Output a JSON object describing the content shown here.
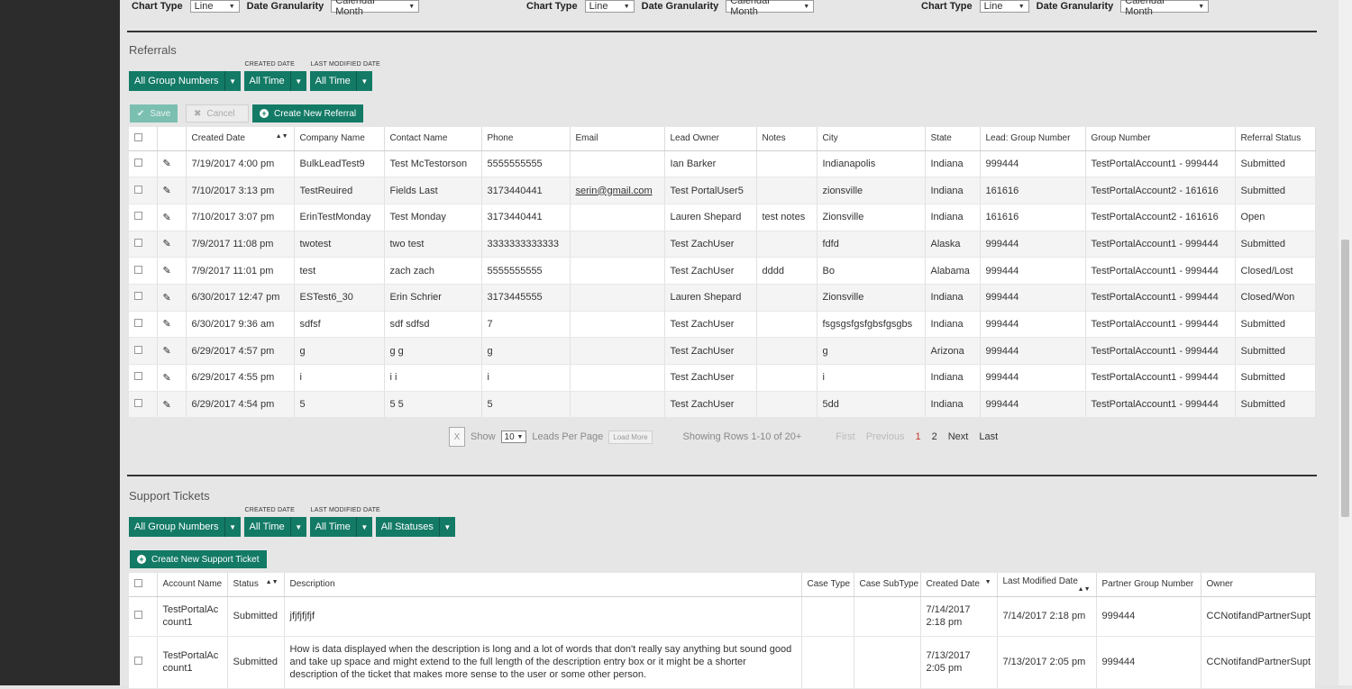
{
  "chart_controls": [
    {
      "chart_type_label": "Chart Type",
      "chart_type_value": "Line",
      "granularity_label": "Date Granularity",
      "granularity_value": "Calendar Month"
    },
    {
      "chart_type_label": "Chart Type",
      "chart_type_value": "Line",
      "granularity_label": "Date Granularity",
      "granularity_value": "Calendar Month"
    },
    {
      "chart_type_label": "Chart Type",
      "chart_type_value": "Line",
      "granularity_label": "Date Granularity",
      "granularity_value": "Calendar Month"
    }
  ],
  "referrals": {
    "title": "Referrals",
    "filters": {
      "group": "All Group Numbers",
      "created_caption": "CREATED DATE",
      "created": "All Time",
      "modified_caption": "LAST MODIFIED DATE",
      "modified": "All Time"
    },
    "save_label": "Save",
    "cancel_label": "Cancel",
    "create_label": "Create New Referral",
    "columns": [
      "Created Date",
      "Company Name",
      "Contact Name",
      "Phone",
      "Email",
      "Lead Owner",
      "Notes",
      "City",
      "State",
      "Lead: Group Number",
      "Group Number",
      "Referral Status"
    ],
    "rows": [
      [
        "7/19/2017 4:00 pm",
        "BulkLeadTest9",
        "Test McTestorson",
        "5555555555",
        "",
        "Ian Barker",
        "",
        "Indianapolis",
        "Indiana",
        "999444",
        "TestPortalAccount1 - 999444",
        "Submitted"
      ],
      [
        "7/10/2017 3:13 pm",
        "TestReuired",
        "Fields Last",
        "3173440441",
        "serin@gmail.com",
        "Test PortalUser5",
        "",
        "zionsville",
        "Indiana",
        "161616",
        "TestPortalAccount2 - 161616",
        "Submitted"
      ],
      [
        "7/10/2017 3:07 pm",
        "ErinTestMonday",
        "Test Monday",
        "3173440441",
        "",
        "Lauren Shepard",
        "test notes",
        "Zionsville",
        "Indiana",
        "161616",
        "TestPortalAccount2 - 161616",
        "Open"
      ],
      [
        "7/9/2017 11:08 pm",
        "twotest",
        "two test",
        "3333333333333",
        "",
        "Test ZachUser",
        "",
        "fdfd",
        "Alaska",
        "999444",
        "TestPortalAccount1 - 999444",
        "Submitted"
      ],
      [
        "7/9/2017 11:01 pm",
        "test",
        "zach zach",
        "5555555555",
        "",
        "Test ZachUser",
        "dddd",
        "Bo",
        "Alabama",
        "999444",
        "TestPortalAccount1 - 999444",
        "Closed/Lost"
      ],
      [
        "6/30/2017 12:47 pm",
        "ESTest6_30",
        "Erin Schrier",
        "3173445555",
        "",
        "Lauren Shepard",
        "",
        "Zionsville",
        "Indiana",
        "999444",
        "TestPortalAccount1 - 999444",
        "Closed/Won"
      ],
      [
        "6/30/2017 9:36 am",
        "sdfsf",
        "sdf sdfsd",
        "7",
        "",
        "Test ZachUser",
        "",
        "fsgsgsfgsfgbsfgsgbs",
        "Indiana",
        "999444",
        "TestPortalAccount1 - 999444",
        "Submitted"
      ],
      [
        "6/29/2017 4:57 pm",
        "g",
        "g g",
        "g",
        "",
        "Test ZachUser",
        "",
        "g",
        "Arizona",
        "999444",
        "TestPortalAccount1 - 999444",
        "Submitted"
      ],
      [
        "6/29/2017 4:55 pm",
        "i",
        "i i",
        "i",
        "",
        "Test ZachUser",
        "",
        "i",
        "Indiana",
        "999444",
        "TestPortalAccount1 - 999444",
        "Submitted"
      ],
      [
        "6/29/2017 4:54 pm",
        "5",
        "5 5",
        "5",
        "",
        "Test ZachUser",
        "",
        "5dd",
        "Indiana",
        "999444",
        "TestPortalAccount1 - 999444",
        "Submitted"
      ]
    ],
    "pager": {
      "excel_icon": "excel-icon",
      "show_label": "Show",
      "per_page": "10",
      "per_page_label": "Leads Per Page",
      "load_more": "Load More",
      "showing": "Showing Rows 1-10 of 20+",
      "first": "First",
      "previous": "Previous",
      "page1": "1",
      "page2": "2",
      "next": "Next",
      "last": "Last"
    }
  },
  "support": {
    "title": "Support Tickets",
    "filters": {
      "group": "All Group Numbers",
      "created_caption": "CREATED DATE",
      "created": "All Time",
      "modified_caption": "LAST MODIFIED DATE",
      "modified": "All Time",
      "status": "All Statuses"
    },
    "create_label": "Create New Support Ticket",
    "columns": [
      "Account Name",
      "Status",
      "Description",
      "Case Type",
      "Case SubType",
      "Created Date",
      "Last Modified Date",
      "Partner Group Number",
      "Owner"
    ],
    "rows": [
      [
        "TestPortalAccount1",
        "Submitted",
        "jfjfjfjfjf",
        "",
        "",
        "7/14/2017 2:18 pm",
        "7/14/2017 2:18 pm",
        "999444",
        "CCNotifandPartnerSupt"
      ],
      [
        "TestPortalAccount1",
        "Submitted",
        "How is data displayed when the description is long and a lot of words that don't really say anything but sound good and take up space and might extend to the full length of the description entry box or it might be a shorter description of the ticket that makes more sense to the user or some other person.",
        "",
        "",
        "7/13/2017 2:05 pm",
        "7/13/2017 2:05 pm",
        "999444",
        "CCNotifandPartnerSupt"
      ]
    ]
  }
}
